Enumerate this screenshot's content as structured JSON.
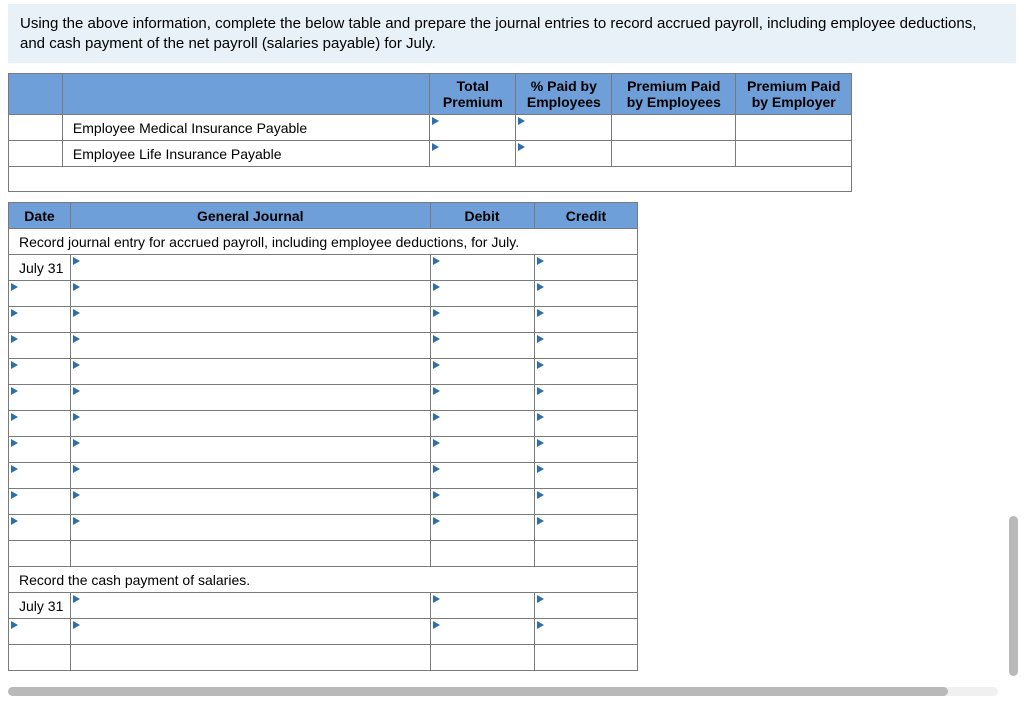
{
  "instruction": "Using the above information, complete the below table and prepare the journal entries to record accrued payroll, including employee deductions, and cash payment of the net payroll (salaries payable) for July.",
  "premium_table": {
    "headers": {
      "total_premium_l1": "Total",
      "total_premium_l2": "Premium",
      "pct_paid_l1": "% Paid by",
      "pct_paid_l2": "Employees",
      "paid_emp_l1": "Premium Paid",
      "paid_emp_l2": "by Employees",
      "paid_er_l1": "Premium Paid",
      "paid_er_l2": "by Employer"
    },
    "row1_label": "Employee Medical Insurance Payable",
    "row2_label": "Employee Life Insurance Payable"
  },
  "journal": {
    "headers": {
      "date": "Date",
      "gj": "General Journal",
      "debit": "Debit",
      "credit": "Credit"
    },
    "instr1": "Record journal entry for accrued payroll, including employee deductions, for July.",
    "instr2": "Record the cash payment of salaries.",
    "date1": "July 31",
    "date2": "July 31"
  }
}
